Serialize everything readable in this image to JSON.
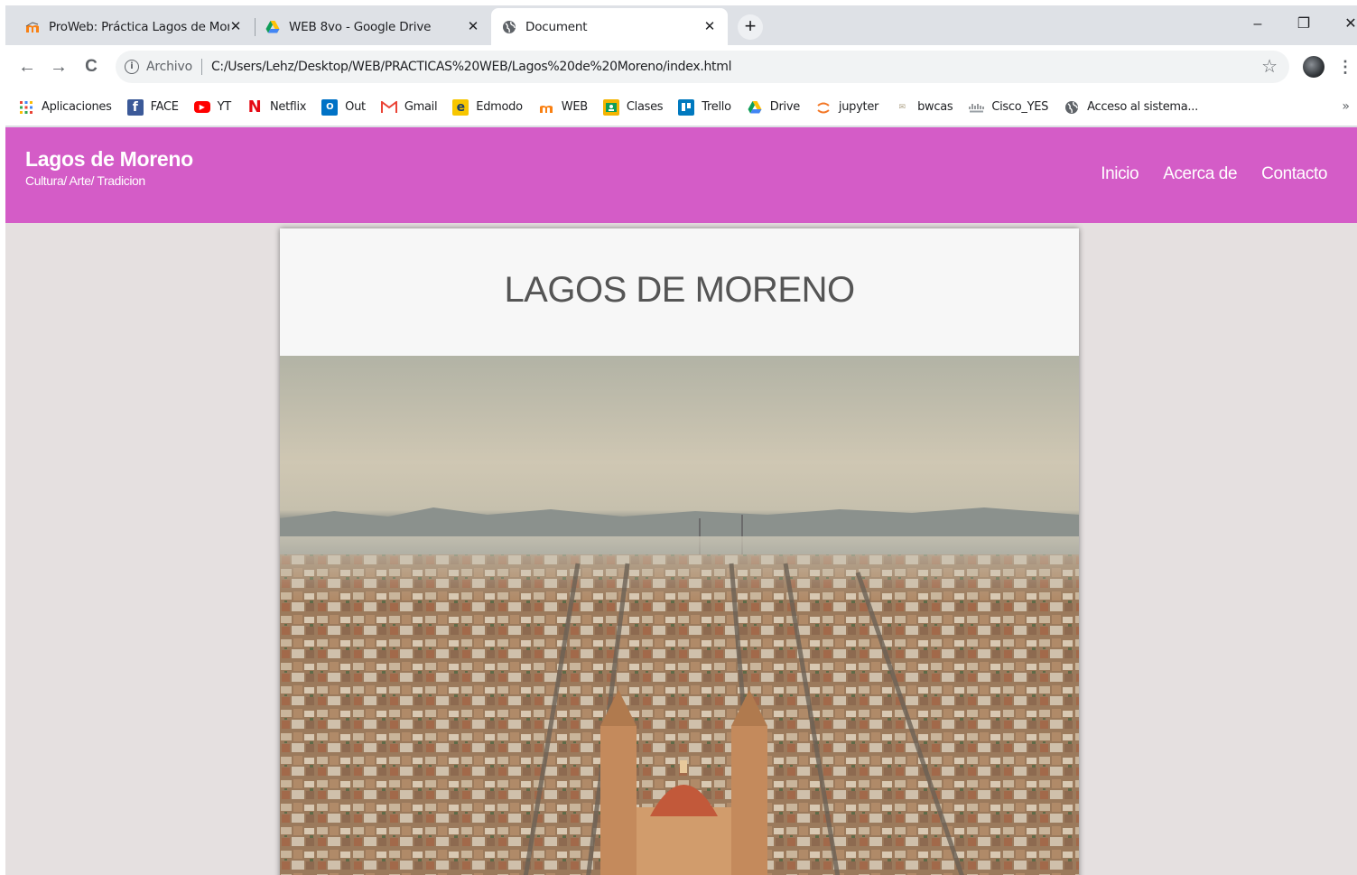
{
  "tabs": [
    {
      "title": "ProWeb: Práctica Lagos de Moreno",
      "icon": "moodle-icon",
      "active": false
    },
    {
      "title": "WEB 8vo - Google Drive",
      "icon": "google-drive-icon",
      "active": false
    },
    {
      "title": "Document",
      "icon": "globe-icon",
      "active": true
    }
  ],
  "new_tab": "+",
  "window_controls": {
    "minimize": "–",
    "restore": "❐",
    "close": "✕"
  },
  "toolbar": {
    "back": "←",
    "forward": "→",
    "reload": "C",
    "origin": "Archivo",
    "url": "C:/Users/Lehz/Desktop/WEB/PRACTICAS%20WEB/Lagos%20de%20Moreno/index.html",
    "star": "☆",
    "menu": "⋮"
  },
  "bookmarks": [
    {
      "label": "Aplicaciones",
      "icon": "apps-grid-icon"
    },
    {
      "label": "FACE",
      "icon": "facebook-icon"
    },
    {
      "label": "YT",
      "icon": "youtube-icon"
    },
    {
      "label": "Netflix",
      "icon": "netflix-icon"
    },
    {
      "label": "Out",
      "icon": "outlook-icon"
    },
    {
      "label": "Gmail",
      "icon": "gmail-icon"
    },
    {
      "label": "Edmodo",
      "icon": "edmodo-icon"
    },
    {
      "label": "WEB",
      "icon": "moodle-icon"
    },
    {
      "label": "Clases",
      "icon": "classroom-icon"
    },
    {
      "label": "Trello",
      "icon": "trello-icon"
    },
    {
      "label": "Drive",
      "icon": "google-drive-icon"
    },
    {
      "label": "jupyter",
      "icon": "jupyter-icon"
    },
    {
      "label": "bwcas",
      "icon": "bwcas-icon"
    },
    {
      "label": "Cisco_YES",
      "icon": "cisco-icon"
    },
    {
      "label": "Acceso al sistema...",
      "icon": "globe-icon"
    }
  ],
  "bookmarks_more": "»",
  "site": {
    "brand_title": "Lagos de Moreno",
    "brand_subtitle": "Cultura/ Arte/ Tradicion",
    "nav": [
      "Inicio",
      "Acerca de",
      "Contacto"
    ],
    "header_color": "#d45cc7",
    "card_title": "LAGOS DE MORENO",
    "hero_image": "aerial-city-photo"
  }
}
